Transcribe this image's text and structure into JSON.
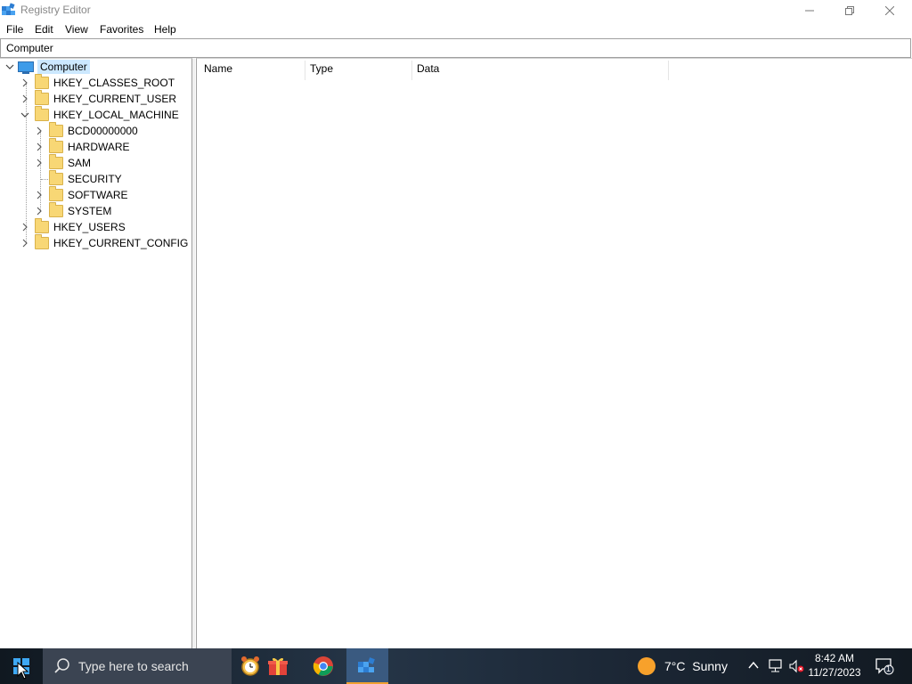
{
  "window": {
    "title": "Registry Editor"
  },
  "menu": [
    "File",
    "Edit",
    "View",
    "Favorites",
    "Help"
  ],
  "address": "Computer",
  "tree": {
    "root": "Computer",
    "hives": [
      {
        "label": "HKEY_CLASSES_ROOT",
        "expanded": false
      },
      {
        "label": "HKEY_CURRENT_USER",
        "expanded": false
      },
      {
        "label": "HKEY_LOCAL_MACHINE",
        "expanded": true,
        "children": [
          "BCD00000000",
          "HARDWARE",
          "SAM",
          "SECURITY",
          "SOFTWARE",
          "SYSTEM"
        ]
      },
      {
        "label": "HKEY_USERS",
        "expanded": false
      },
      {
        "label": "HKEY_CURRENT_CONFIG",
        "expanded": false
      }
    ]
  },
  "list": {
    "columns": [
      "Name",
      "Type",
      "Data"
    ]
  },
  "taskbar": {
    "search_placeholder": "Type here to search",
    "weather_text": "7°C  Sunny",
    "time": "8:42 AM",
    "date": "11/27/2023",
    "notification_count": "1"
  },
  "colors": {
    "selection": "#cce8ff",
    "folder": "#f8d775",
    "taskbar": "#1e2a3a",
    "accent": "#f0a030"
  }
}
